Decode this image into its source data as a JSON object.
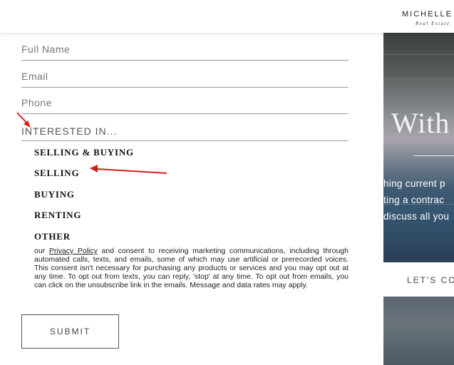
{
  "header": {
    "brand_name": "MICHELLE",
    "brand_sub": "Real Estate"
  },
  "form": {
    "full_name_placeholder": "Full Name",
    "email_placeholder": "Email",
    "phone_placeholder": "Phone",
    "interested_label": "INTERESTED IN...",
    "options": [
      "SELLING & BUYING",
      "SELLING",
      "BUYING",
      "RENTING",
      "OTHER"
    ],
    "consent_prefix": "our ",
    "privacy_link": "Privacy Policy",
    "consent_text": " and consent to receiving marketing communications, including through automated calls, texts, and emails, some of which may use artificial or prerecorded voices. This consent isn't necessary for purchasing any products or services and you may opt out at any time. To opt out from texts, you can reply, 'stop' at any time. To opt out from emails, you can click on the unsubscribe link in the emails. Message and data rates may apply.",
    "submit_label": "SUBMIT"
  },
  "side": {
    "heading": "With",
    "line1": "hing current p",
    "line2": "ting a contrac",
    "line3": "discuss all you",
    "cta": "LET'S CO"
  },
  "colors": {
    "annotation_arrow": "#d11f1f"
  }
}
